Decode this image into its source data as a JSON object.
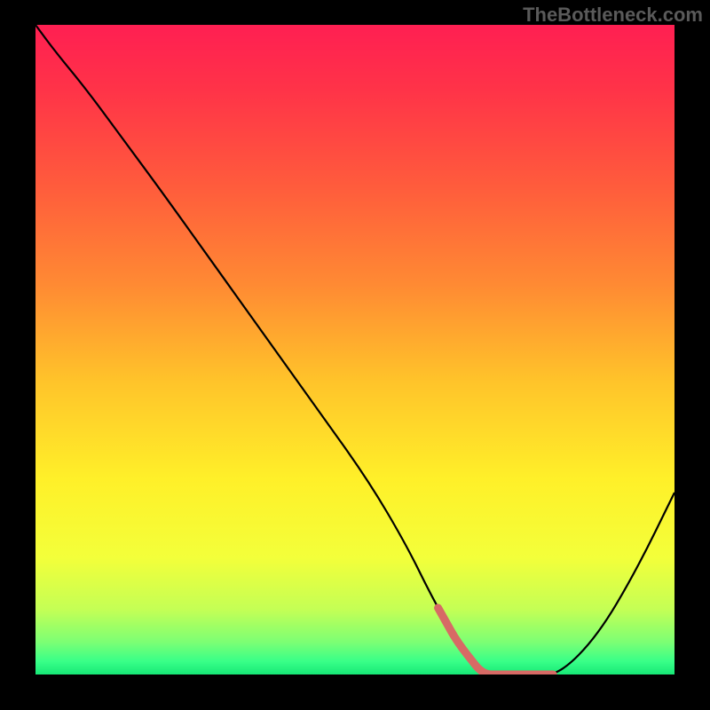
{
  "watermark": "TheBottleneck.com",
  "colors": {
    "black": "#000000",
    "curve": "#000000",
    "highlight": "#d76a65",
    "watermark_text": "#5a5a5a"
  },
  "gradient_stops": [
    {
      "offset": 0.0,
      "color": "#ff1f52"
    },
    {
      "offset": 0.1,
      "color": "#ff3348"
    },
    {
      "offset": 0.25,
      "color": "#ff5c3c"
    },
    {
      "offset": 0.4,
      "color": "#ff8a33"
    },
    {
      "offset": 0.55,
      "color": "#ffc42a"
    },
    {
      "offset": 0.7,
      "color": "#fff029"
    },
    {
      "offset": 0.82,
      "color": "#f3ff3a"
    },
    {
      "offset": 0.9,
      "color": "#c4ff55"
    },
    {
      "offset": 0.95,
      "color": "#7cff74"
    },
    {
      "offset": 0.98,
      "color": "#38ff88"
    },
    {
      "offset": 1.0,
      "color": "#17e876"
    }
  ],
  "chart_data": {
    "type": "line",
    "title": "",
    "xlabel": "",
    "ylabel": "",
    "xlim": [
      0,
      100
    ],
    "ylim": [
      0,
      100
    ],
    "x": [
      0,
      3,
      8,
      14,
      20,
      28,
      36,
      44,
      52,
      58,
      62,
      66,
      70,
      74,
      78,
      82,
      88,
      94,
      100
    ],
    "values": [
      100,
      96,
      90,
      82,
      74,
      63,
      52,
      41,
      30,
      20,
      12,
      5,
      0,
      0,
      0,
      0,
      6,
      16,
      28
    ],
    "highlight_x_range": [
      63,
      81
    ],
    "annotations": []
  }
}
